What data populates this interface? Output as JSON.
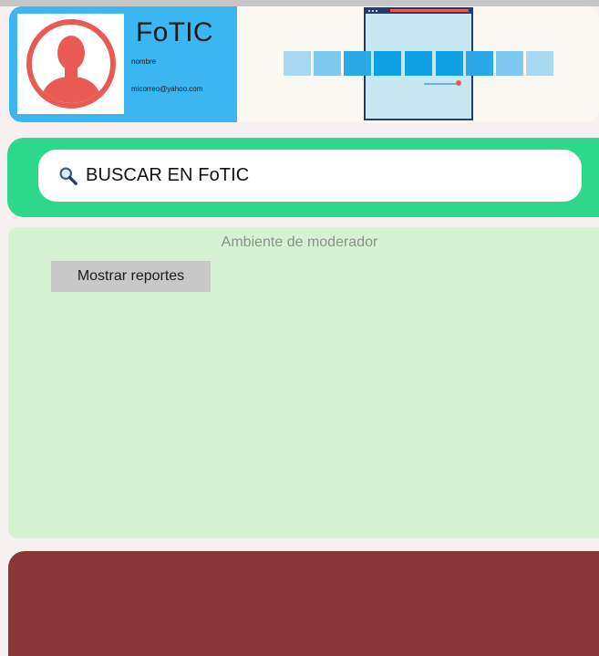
{
  "header": {
    "app_title": "FoTIC",
    "user_name": "nombre",
    "user_email": "micorreo@yahoo.com",
    "avatar_icon": "user-avatar-icon",
    "banner_icon": "app-preview-illustration",
    "colors": {
      "profile_bg": "#3cb6f0",
      "avatar_ring": "#e85b55",
      "banner_bg": "#fbf8f1"
    }
  },
  "search": {
    "icon": "search-icon",
    "label": "BUSCAR EN FoTIC",
    "colors": {
      "area_bg": "#2ed88a",
      "pill_bg": "#ffffff"
    }
  },
  "moderator": {
    "title": "Ambiente de moderador",
    "show_reports_label": "Mostrar reportes",
    "colors": {
      "panel_bg": "#d5f3d3",
      "button_bg": "#c8c8c8"
    }
  },
  "footer": {
    "colors": {
      "bar_bg": "#8b3739"
    }
  }
}
